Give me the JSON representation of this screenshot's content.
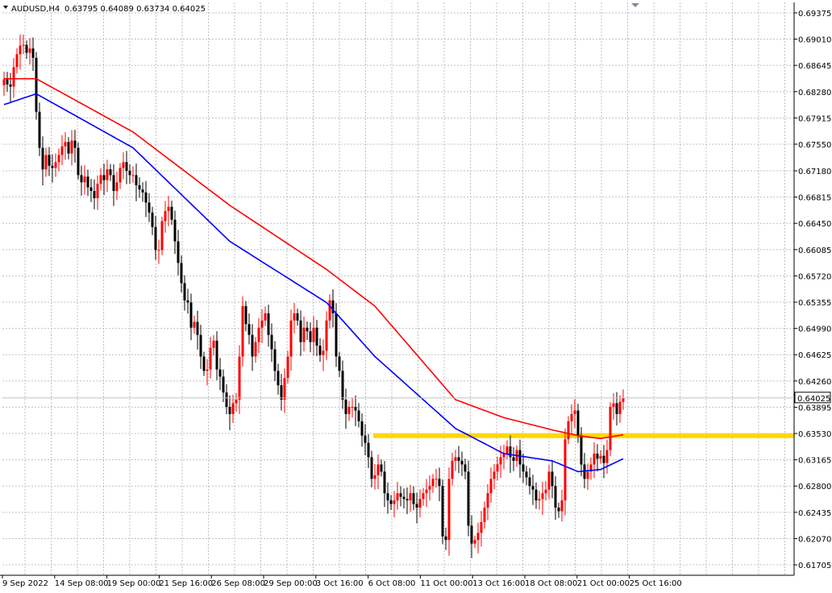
{
  "header": {
    "symbol_label": "AUDUSD,H4",
    "ohlc_label": "0.63795 0.64089 0.63734 0.64025"
  },
  "chart_data": {
    "type": "candlestick",
    "symbol": "AUDUSD",
    "timeframe": "H4",
    "ohlc": {
      "open": 0.63795,
      "high": 0.64089,
      "low": 0.63734,
      "close": 0.64025
    },
    "current_price_label": "0.64025",
    "ylim": [
      0.6156,
      0.6952
    ],
    "y_ticks": [
      "0.69375",
      "0.69010",
      "0.68645",
      "0.68280",
      "0.67915",
      "0.67550",
      "0.67180",
      "0.66815",
      "0.66450",
      "0.66085",
      "0.65720",
      "0.65355",
      "0.64990",
      "0.64625",
      "0.64260",
      "0.63895",
      "0.63530",
      "0.63165",
      "0.62800",
      "0.62435",
      "0.62070",
      "0.61705"
    ],
    "x_ticks": [
      "9 Sep 2022",
      "14 Sep 08:00",
      "19 Sep 00:00",
      "21 Sep 16:00",
      "26 Sep 08:00",
      "29 Sep 00:00",
      "3 Oct 16:00",
      "6 Oct 08:00",
      "11 Oct 00:00",
      "13 Oct 16:00",
      "18 Oct 08:00",
      "21 Oct 00:00",
      "25 Oct 16:00"
    ],
    "closes": [
      0.6845,
      0.6838,
      0.6835,
      0.6862,
      0.688,
      0.6892,
      0.6893,
      0.6882,
      0.6888,
      0.6875,
      0.68,
      0.675,
      0.672,
      0.674,
      0.6725,
      0.6722,
      0.673,
      0.674,
      0.6752,
      0.6758,
      0.6742,
      0.676,
      0.675,
      0.6712,
      0.6702,
      0.671,
      0.6695,
      0.669,
      0.668,
      0.67,
      0.6712,
      0.6705,
      0.672,
      0.6712,
      0.669,
      0.6702,
      0.6722,
      0.673,
      0.6718,
      0.6712,
      0.6712,
      0.6698,
      0.6692,
      0.6688,
      0.6674,
      0.666,
      0.664,
      0.6608,
      0.6608,
      0.6648,
      0.6662,
      0.6668,
      0.665,
      0.662,
      0.659,
      0.6562,
      0.6538,
      0.6535,
      0.65,
      0.6508,
      0.649,
      0.646,
      0.644,
      0.6442,
      0.6472,
      0.6482,
      0.6442,
      0.6432,
      0.641,
      0.639,
      0.638,
      0.6395,
      0.64,
      0.646,
      0.653,
      0.6505,
      0.649,
      0.646,
      0.648,
      0.65,
      0.651,
      0.652,
      0.649,
      0.647,
      0.644,
      0.642,
      0.64,
      0.643,
      0.646,
      0.651,
      0.652,
      0.651,
      0.648,
      0.65,
      0.6495,
      0.648,
      0.65,
      0.6475,
      0.6462,
      0.6468,
      0.651,
      0.6538,
      0.652,
      0.646,
      0.644,
      0.64,
      0.638,
      0.639,
      0.639,
      0.6385,
      0.637,
      0.635,
      0.634,
      0.632,
      0.629,
      0.6295,
      0.631,
      0.63,
      0.627,
      0.626,
      0.6255,
      0.626,
      0.627,
      0.6265,
      0.6262,
      0.626,
      0.627,
      0.6255,
      0.625,
      0.6262,
      0.627,
      0.6275,
      0.628,
      0.629,
      0.629,
      0.628,
      0.621,
      0.6205,
      0.629,
      0.6315,
      0.632,
      0.6315,
      0.631,
      0.63,
      0.6225,
      0.62,
      0.6205,
      0.6215,
      0.623,
      0.625,
      0.627,
      0.629,
      0.63,
      0.631,
      0.632,
      0.6325,
      0.6335,
      0.632,
      0.6315,
      0.633,
      0.631,
      0.63,
      0.6292,
      0.628,
      0.6275,
      0.626,
      0.6262,
      0.627,
      0.6275,
      0.63,
      0.628,
      0.625,
      0.6245,
      0.626,
      0.6345,
      0.637,
      0.638,
      0.6385,
      0.635,
      0.631,
      0.629,
      0.63,
      0.631,
      0.6325,
      0.6318,
      0.6322,
      0.6312,
      0.633,
      0.639,
      0.6395,
      0.638,
      0.6397,
      0.6402
    ],
    "ma_red_anchors": [
      [
        0,
        0.6846
      ],
      [
        10,
        0.6846
      ],
      [
        40,
        0.6772
      ],
      [
        70,
        0.667
      ],
      [
        100,
        0.6581
      ],
      [
        115,
        0.653
      ],
      [
        140,
        0.64
      ],
      [
        155,
        0.6375
      ],
      [
        170,
        0.6358
      ],
      [
        178,
        0.635
      ],
      [
        185,
        0.6346
      ],
      [
        193,
        0.6352
      ]
    ],
    "ma_blue_anchors": [
      [
        0,
        0.681
      ],
      [
        10,
        0.6825
      ],
      [
        40,
        0.675
      ],
      [
        70,
        0.662
      ],
      [
        100,
        0.6535
      ],
      [
        115,
        0.646
      ],
      [
        140,
        0.636
      ],
      [
        155,
        0.6325
      ],
      [
        170,
        0.6315
      ],
      [
        178,
        0.63
      ],
      [
        185,
        0.6303
      ],
      [
        193,
        0.632
      ]
    ],
    "support_level": 0.635,
    "support_start_index": 115,
    "colors": {
      "bull": "#ff0000",
      "bear": "#000000",
      "ma_red": "#ff0000",
      "ma_blue": "#0000ff",
      "support": "#ffd700",
      "grid": "#c0c0c0",
      "price_line": "#c0c0c0"
    }
  }
}
